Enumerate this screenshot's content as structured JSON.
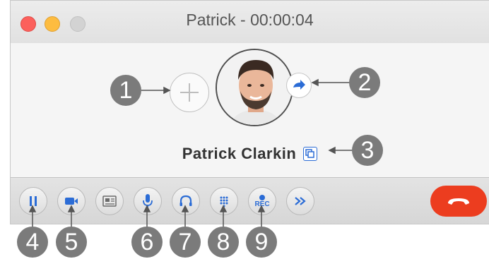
{
  "window": {
    "title": "Patrick - 00:00:04"
  },
  "contact": {
    "name": "Patrick Clarkin"
  },
  "toolbar": {
    "rec_label": "REC"
  },
  "callouts": [
    "1",
    "2",
    "3",
    "4",
    "5",
    "6",
    "7",
    "8",
    "9"
  ],
  "icons": {
    "add": "plus-icon",
    "transfer": "transfer-arrow-icon",
    "copy": "copy-icon",
    "hold": "pause-icon",
    "video": "video-camera-icon",
    "contact_card": "contact-card-icon",
    "mute": "microphone-icon",
    "audio": "headset-icon",
    "keypad": "keypad-icon",
    "record": "record-icon",
    "more": "double-chevron-icon",
    "hangup": "phone-hangup-icon"
  },
  "colors": {
    "accent": "#2b6cd6",
    "hangup": "#ec3d1f",
    "callout": "#7b7b7b"
  }
}
